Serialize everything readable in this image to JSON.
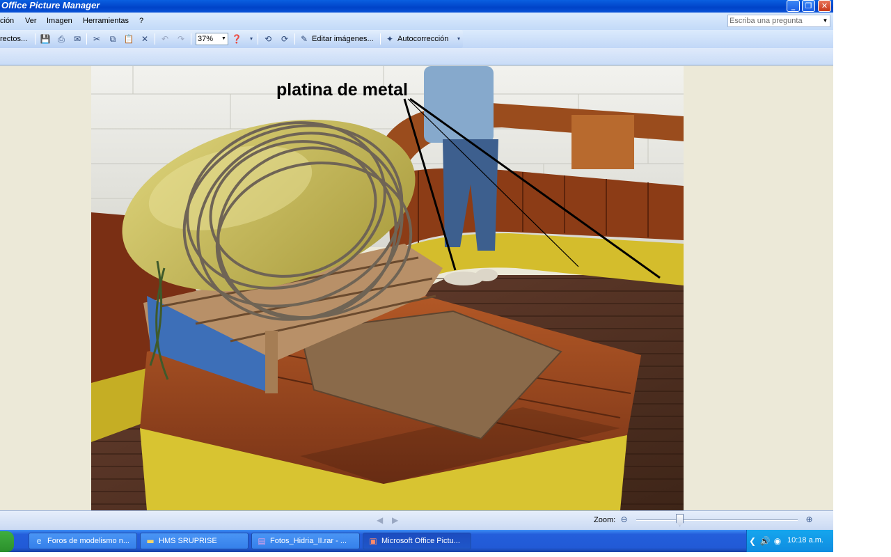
{
  "window": {
    "title": "Office Picture Manager",
    "controls": {
      "minimize": "_",
      "maximize": "❐",
      "close": "✕"
    }
  },
  "menubar": {
    "items": [
      "ción",
      "Ver",
      "Imagen",
      "Herramientas",
      "?"
    ],
    "help_placeholder": "Escriba una pregunta"
  },
  "toolbar": {
    "shortcuts_label": "rectos...",
    "zoom_value": "37%",
    "edit_images_label": "Editar imágenes...",
    "autocorrect_label": "Autocorrección"
  },
  "photo": {
    "annotation": "platina de metal"
  },
  "statusbar": {
    "zoom_label": "Zoom:",
    "zoom_level_fraction": 0.27
  },
  "taskbar": {
    "tasks": [
      {
        "label": "Foros de modelismo n...",
        "icon": "internet-explorer-icon"
      },
      {
        "label": "HMS SRUPRISE",
        "icon": "folder-icon"
      },
      {
        "label": "Fotos_Hidria_II.rar - ...",
        "icon": "winrar-icon"
      },
      {
        "label": "Microsoft Office Pictu...",
        "icon": "picture-manager-icon"
      }
    ],
    "clock": "10:18 a.m."
  },
  "colors": {
    "titlebar": "#0043c8",
    "deck_wood": "#7a3a1c",
    "hull_yellow": "#d7c22a",
    "canvas_bag": "#c8b955"
  }
}
